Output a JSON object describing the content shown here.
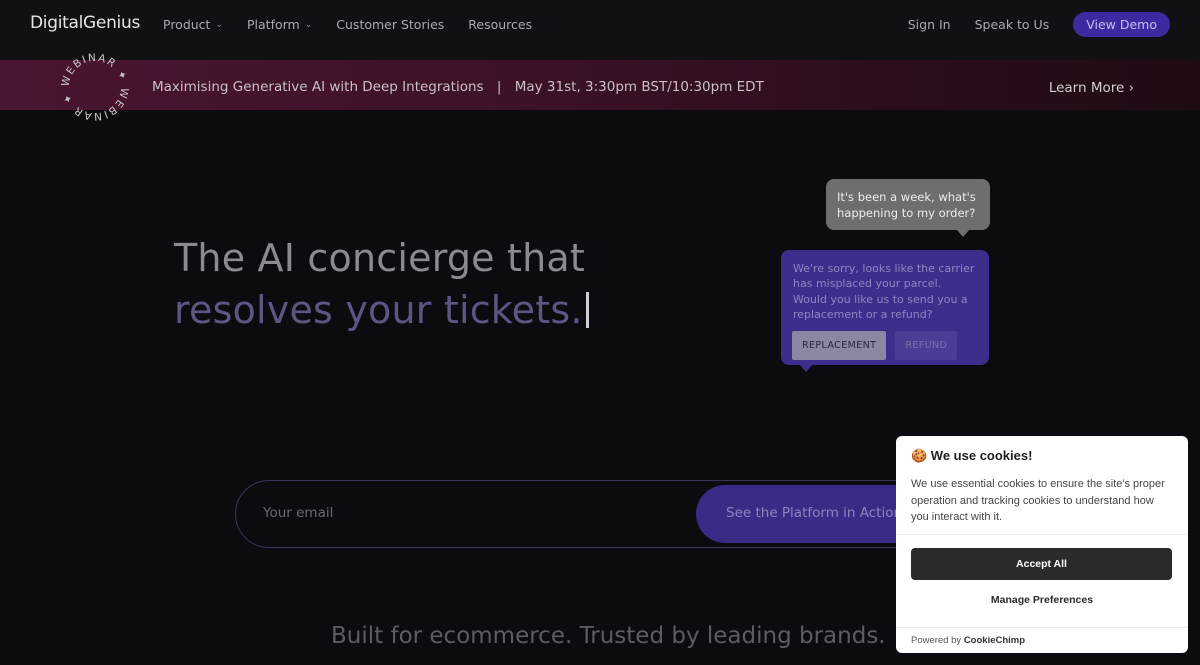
{
  "nav": {
    "logo": "DigitalGenius",
    "links": [
      {
        "label": "Product",
        "has_dropdown": true
      },
      {
        "label": "Platform",
        "has_dropdown": true
      },
      {
        "label": "Customer Stories",
        "has_dropdown": false
      },
      {
        "label": "Resources",
        "has_dropdown": false
      }
    ],
    "sign_in": "Sign In",
    "speak": "Speak to Us",
    "demo": "View Demo"
  },
  "banner": {
    "badge_text": "WEBINAR ✦ WEBINAR ✦",
    "title": "Maximising Generative AI with Deep Integrations",
    "separator": "|",
    "date": "May 31st, 3:30pm BST/10:30pm EDT",
    "cta": "Learn More ›"
  },
  "hero": {
    "line1": "The AI concierge that",
    "line2": "resolves your tickets."
  },
  "chat": {
    "user_message": "It's been a week, what's happening to my order?",
    "bot_message": "We're sorry, looks like the carrier has misplaced your parcel. Would you like us to send you a replacement or a refund?",
    "buttons": [
      "REPLACEMENT",
      "REFUND"
    ]
  },
  "form": {
    "email_placeholder": "Your email",
    "cta": "See the Platform in Action"
  },
  "trusted": "Built for ecommerce. Trusted by leading brands.",
  "cookie": {
    "title": "🍪 We use cookies!",
    "body": "We use essential cookies to ensure the site's proper operation and tracking cookies to understand how you interact with it.",
    "accept": "Accept All",
    "manage": "Manage Preferences",
    "powered_prefix": "Powered by ",
    "powered_brand": "CookieChimp"
  },
  "colors": {
    "background": "#0b0b10",
    "accent": "#3d2aa0",
    "banner": "#4a1530"
  }
}
